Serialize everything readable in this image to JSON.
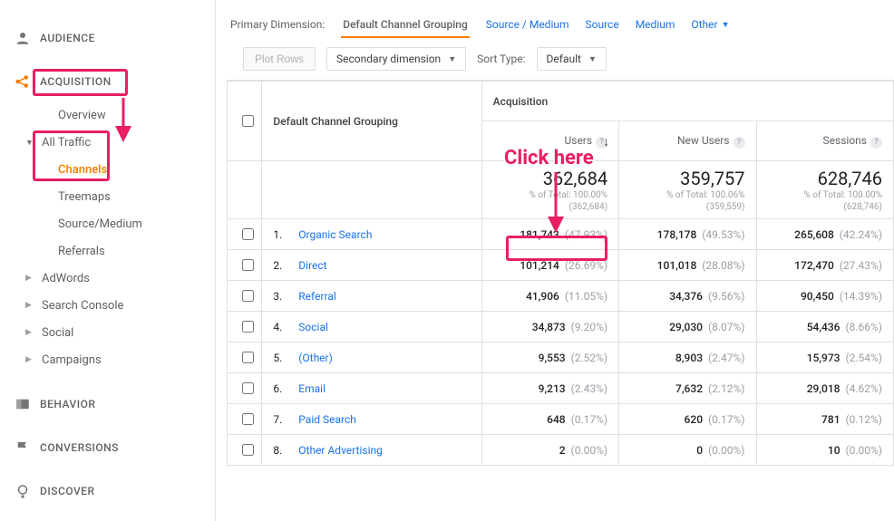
{
  "sidebar": {
    "audience": "AUDIENCE",
    "acquisition": "ACQUISITION",
    "overview": "Overview",
    "all_traffic": "All Traffic",
    "channels": "Channels",
    "treemaps": "Treemaps",
    "source_medium": "Source/Medium",
    "referrals": "Referrals",
    "adwords": "AdWords",
    "search_console": "Search Console",
    "social": "Social",
    "campaigns": "Campaigns",
    "behavior": "BEHAVIOR",
    "conversions": "CONVERSIONS",
    "discover": "DISCOVER"
  },
  "dim": {
    "label": "Primary Dimension:",
    "primary": "Default Channel Grouping",
    "source_medium": "Source / Medium",
    "source": "Source",
    "medium": "Medium",
    "other": "Other"
  },
  "controls": {
    "plot": "Plot Rows",
    "secondary": "Secondary dimension",
    "sort_label": "Sort Type:",
    "default": "Default"
  },
  "table": {
    "dim_head": "Default Channel Grouping",
    "acq_head": "Acquisition",
    "users": "Users",
    "new_users": "New Users",
    "sessions": "Sessions"
  },
  "totals": {
    "users": {
      "v": "362,684",
      "sub": "% of Total: 100.00% (362,684)"
    },
    "new_users": {
      "v": "359,757",
      "sub": "% of Total: 100.06% (359,559)"
    },
    "sessions": {
      "v": "628,746",
      "sub": "% of Total: 100.00% (628,746)"
    }
  },
  "rows": [
    {
      "n": "1.",
      "name": "Organic Search",
      "u": "181,743",
      "up": "(47.93%)",
      "nu": "178,178",
      "nup": "(49.53%)",
      "s": "265,608",
      "sp": "(42.24%)"
    },
    {
      "n": "2.",
      "name": "Direct",
      "u": "101,214",
      "up": "(26.69%)",
      "nu": "101,018",
      "nup": "(28.08%)",
      "s": "172,470",
      "sp": "(27.43%)"
    },
    {
      "n": "3.",
      "name": "Referral",
      "u": "41,906",
      "up": "(11.05%)",
      "nu": "34,376",
      "nup": "(9.56%)",
      "s": "90,450",
      "sp": "(14.39%)"
    },
    {
      "n": "4.",
      "name": "Social",
      "u": "34,873",
      "up": "(9.20%)",
      "nu": "29,030",
      "nup": "(8.07%)",
      "s": "54,436",
      "sp": "(8.66%)"
    },
    {
      "n": "5.",
      "name": "(Other)",
      "u": "9,553",
      "up": "(2.52%)",
      "nu": "8,903",
      "nup": "(2.47%)",
      "s": "15,973",
      "sp": "(2.54%)"
    },
    {
      "n": "6.",
      "name": "Email",
      "u": "9,213",
      "up": "(2.43%)",
      "nu": "7,632",
      "nup": "(2.12%)",
      "s": "29,018",
      "sp": "(4.62%)"
    },
    {
      "n": "7.",
      "name": "Paid Search",
      "u": "648",
      "up": "(0.17%)",
      "nu": "620",
      "nup": "(0.17%)",
      "s": "781",
      "sp": "(0.12%)"
    },
    {
      "n": "8.",
      "name": "Other Advertising",
      "u": "2",
      "up": "(0.00%)",
      "nu": "0",
      "nup": "(0.00%)",
      "s": "10",
      "sp": "(0.00%)"
    }
  ],
  "anno": {
    "click_here": "Click here"
  }
}
